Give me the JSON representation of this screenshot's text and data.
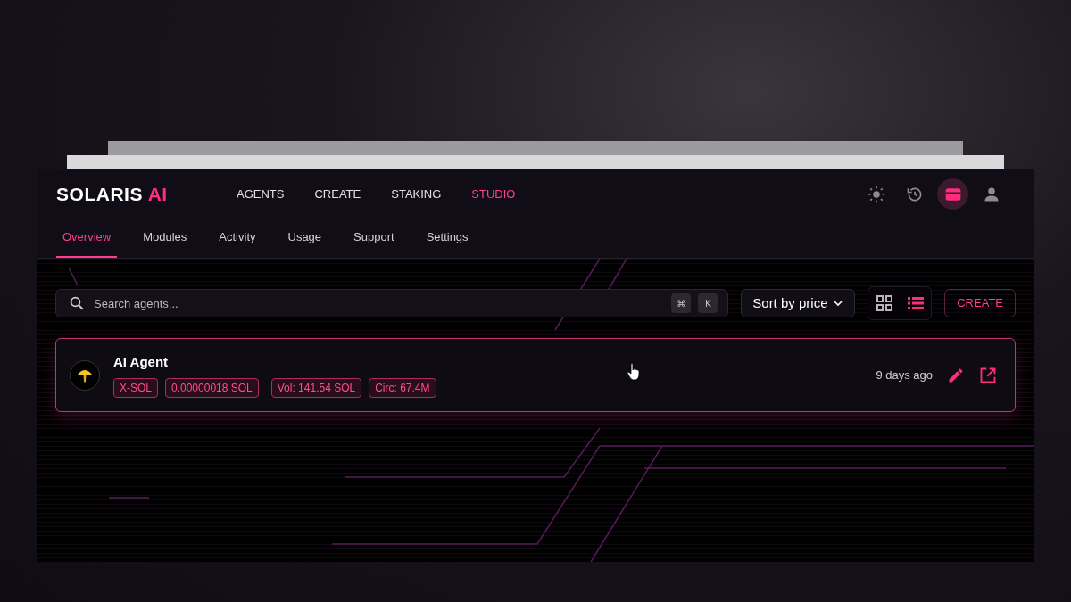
{
  "brand": {
    "name": "SOLARIS",
    "accent": "AI"
  },
  "nav": [
    {
      "label": "AGENTS",
      "selected": false
    },
    {
      "label": "CREATE",
      "selected": false
    },
    {
      "label": "STAKING",
      "selected": false
    },
    {
      "label": "STUDIO",
      "selected": true
    }
  ],
  "header_icons": [
    {
      "kind": "theme",
      "selected": false
    },
    {
      "kind": "history",
      "selected": false
    },
    {
      "kind": "wallet",
      "selected": true
    },
    {
      "kind": "account",
      "selected": false
    }
  ],
  "tabs": [
    {
      "label": "Overview",
      "selected": true
    },
    {
      "label": "Modules",
      "selected": false
    },
    {
      "label": "Activity",
      "selected": false
    },
    {
      "label": "Usage",
      "selected": false
    },
    {
      "label": "Support",
      "selected": false
    },
    {
      "label": "Settings",
      "selected": false
    }
  ],
  "search": {
    "placeholder": "Search agents...",
    "keys": [
      "⌘",
      "K"
    ]
  },
  "sort": {
    "label": "Sort by price"
  },
  "view_toggle": [
    {
      "kind": "grid",
      "selected": false
    },
    {
      "kind": "list",
      "selected": true
    }
  ],
  "create_button": "CREATE",
  "agents": [
    {
      "name": "AI Agent",
      "tags": [
        "X-SOL",
        "0.00000018 SOL",
        "Vol: 141.54 SOL",
        "Circ: 67.4M"
      ],
      "time": "9 days ago"
    }
  ]
}
